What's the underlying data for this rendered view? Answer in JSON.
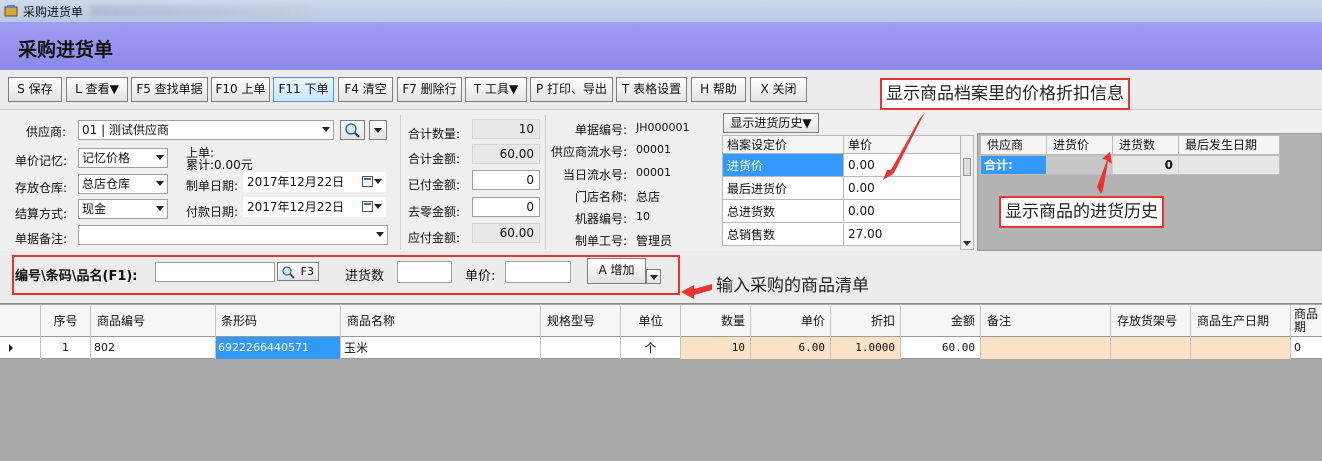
{
  "window": {
    "title": "采购进货单"
  },
  "page": {
    "title": "采购进货单"
  },
  "toolbar": {
    "buttons": [
      {
        "key": "S",
        "label": "S 保存"
      },
      {
        "key": "L",
        "label": "L 查看▼"
      },
      {
        "key": "F5",
        "label": "F5 查找单据"
      },
      {
        "key": "F10",
        "label": "F10 上单"
      },
      {
        "key": "F11",
        "label": "F11 下单"
      },
      {
        "key": "F4",
        "label": "F4 清空"
      },
      {
        "key": "F7",
        "label": "F7 删除行"
      },
      {
        "key": "T1",
        "label": "T 工具▼"
      },
      {
        "key": "P",
        "label": "P 打印、导出"
      },
      {
        "key": "T2",
        "label": "T 表格设置"
      },
      {
        "key": "H",
        "label": "H 帮助"
      },
      {
        "key": "X",
        "label": "X 关闭"
      }
    ]
  },
  "annotations": {
    "price_info": "显示商品档案里的价格折扣信息",
    "history": "显示商品的进货历史",
    "entry": "输入采购的商品清单"
  },
  "form": {
    "supplier_label": "供应商:",
    "supplier_value": "01 | 测试供应商",
    "price_memory_label": "单价记忆:",
    "price_memory_value": "记忆价格",
    "last_order_label": "上单:",
    "accum_label": "累计:0.00元",
    "warehouse_label": "存放仓库:",
    "warehouse_value": "总店仓库",
    "create_date_label": "制单日期:",
    "create_date_value": "2017年12月22日",
    "settle_label": "结算方式:",
    "settle_value": "现金",
    "pay_date_label": "付款日期:",
    "pay_date_value": "2017年12月22日",
    "remark_label": "单据备注:",
    "remark_value": ""
  },
  "totals": {
    "qty_label": "合计数量:",
    "qty_value": "10",
    "amount_label": "合计金额:",
    "amount_value": "60.00",
    "paid_label": "已付金额:",
    "paid_value": "0",
    "round_label": "去零金额:",
    "round_value": "0",
    "payable_label": "应付金额:",
    "payable_value": "60.00"
  },
  "info": {
    "doc_no_label": "单据编号:",
    "doc_no_value": "JH000001",
    "supplier_serial_label": "供应商流水号:",
    "supplier_serial_value": "00001",
    "day_serial_label": "当日流水号:",
    "day_serial_value": "00001",
    "store_label": "门店名称:",
    "store_value": "总店",
    "machine_label": "机器编号:",
    "machine_value": "10",
    "operator_label": "制单工号:",
    "operator_value": "管理员"
  },
  "price_grid": {
    "history_button": "显示进货历史▼",
    "headers": [
      "档案设定价",
      "单价"
    ],
    "rows": [
      {
        "name": "进货价",
        "value": "0.00"
      },
      {
        "name": "最后进货价",
        "value": "0.00"
      },
      {
        "name": "总进货数",
        "value": "0.00"
      },
      {
        "name": "总销售数",
        "value": "27.00"
      }
    ]
  },
  "history_grid": {
    "headers": [
      "供应商",
      "进货价",
      "进货数",
      "最后发生日期"
    ],
    "sum_label": "合计:",
    "sum_qty": "0"
  },
  "entry": {
    "code_label": "编号\\条码\\品名(F1):",
    "code_value": "",
    "search_button": "F3",
    "qty_label": "进货数",
    "qty_value": "",
    "price_label": "单价:",
    "price_value": "",
    "add_button": "A 增加"
  },
  "table": {
    "headers": [
      "序号",
      "商品编号",
      "条形码",
      "商品名称",
      "规格型号",
      "单位",
      "数量",
      "单价",
      "折扣",
      "金额",
      "备注",
      "存放货架号",
      "商品生产日期",
      "商品期"
    ],
    "rows": [
      {
        "seq": "1",
        "code": "802",
        "barcode": "6922266440571",
        "name": "玉米",
        "spec": "",
        "unit": "个",
        "qty": "10",
        "price": "6.00",
        "discount": "1.0000",
        "amount": "60.00",
        "remark": "",
        "shelf": "",
        "prod_date": "",
        "period": "0"
      }
    ]
  },
  "colors": {
    "header_bg": "#9f9cf2",
    "annotation_border": "#e8332f",
    "selection": "#3399ff",
    "peach": "#fde3c6"
  }
}
